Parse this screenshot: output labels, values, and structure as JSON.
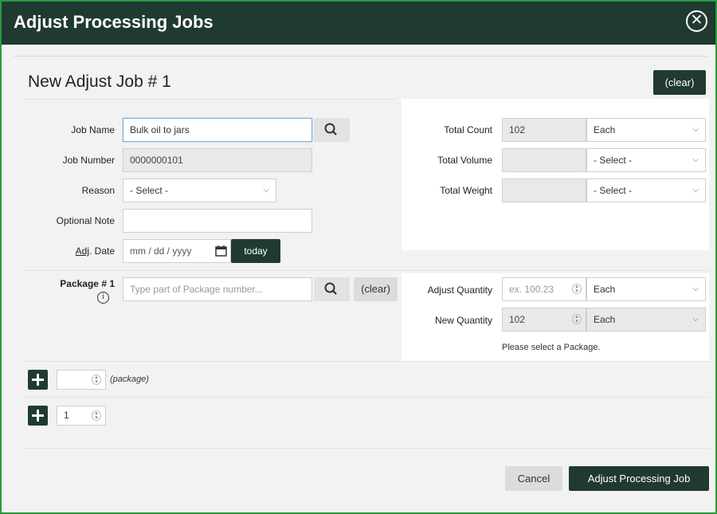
{
  "dialog": {
    "title": "Adjust Processing Jobs",
    "close_icon": "circle-x-icon",
    "heading": "New Adjust Job # 1",
    "clear_label": "(clear)"
  },
  "form": {
    "job_name": {
      "label": "Job Name",
      "value": "Bulk oil to jars"
    },
    "job_number": {
      "label": "Job Number",
      "value": "0000000101"
    },
    "reason": {
      "label": "Reason",
      "value": "- Select -"
    },
    "optional_note": {
      "label": "Optional Note",
      "value": ""
    },
    "adj_date": {
      "label_prefix": "Adj",
      "label_suffix": ". Date",
      "placeholder": "mm / dd / yyyy",
      "today_label": "today"
    },
    "total_count": {
      "label": "Total Count",
      "value": "102",
      "unit": "Each"
    },
    "total_volume": {
      "label": "Total Volume",
      "value": "",
      "unit": "- Select -"
    },
    "total_weight": {
      "label": "Total Weight",
      "value": "",
      "unit": "- Select -"
    }
  },
  "package": {
    "label": "Package # 1",
    "info_icon": "i",
    "placeholder": "Type part of Package number...",
    "clear_label": "(clear)",
    "adjust_quantity": {
      "label": "Adjust Quantity",
      "placeholder": "ex. 100.23",
      "unit": "Each"
    },
    "new_quantity": {
      "label": "New Quantity",
      "value": "102",
      "unit": "Each"
    },
    "note": "Please select a Package."
  },
  "adders": {
    "package_count": "",
    "package_label": "(package)",
    "job_count": "1"
  },
  "footer": {
    "cancel_label": "Cancel",
    "submit_label": "Adjust Processing Job"
  },
  "icons": {
    "search": "search-icon",
    "calendar": "calendar-icon",
    "plus": "plus-icon",
    "chevron": "chevron-down-icon",
    "spinner": "spinner-icon"
  },
  "colors": {
    "header_bg": "#203a30",
    "accent_border": "#2a9a3e",
    "body_bg": "#f2f2f2"
  }
}
